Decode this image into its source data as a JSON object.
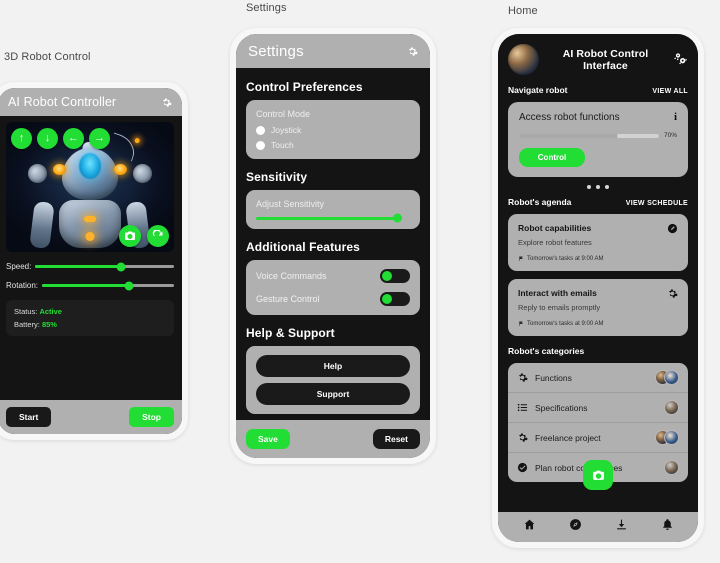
{
  "panels": {
    "robot_control": {
      "label": "3D Robot Control",
      "header": {
        "title": "AI Robot Controller",
        "gear_icon": "gear-icon"
      },
      "dpad": [
        {
          "name": "move-up",
          "glyph": "↑"
        },
        {
          "name": "move-down",
          "glyph": "↓"
        },
        {
          "name": "move-left",
          "glyph": "←"
        },
        {
          "name": "move-right",
          "glyph": "→"
        }
      ],
      "viewport_actions": [
        {
          "name": "camera-icon"
        },
        {
          "name": "refresh-icon"
        }
      ],
      "sliders": [
        {
          "label": "Speed:",
          "value": 62
        },
        {
          "label": "Rotation:",
          "value": 66
        }
      ],
      "status": {
        "status_label": "Status:",
        "status_value": "Active",
        "battery_label": "Battery:",
        "battery_value": "85%"
      },
      "footer": {
        "start_label": "Start",
        "stop_label": "Stop"
      }
    },
    "settings": {
      "label": "Settings",
      "header": {
        "title": "Settings",
        "gear_icon": "gear-icon"
      },
      "sections": {
        "control_preferences": {
          "title": "Control Preferences",
          "card_label": "Control Mode",
          "options": [
            "Joystick",
            "Touch"
          ]
        },
        "sensitivity": {
          "title": "Sensitivity",
          "card_label": "Adjust Sensitivity",
          "value": 88
        },
        "additional_features": {
          "title": "Additional Features",
          "toggles": [
            {
              "label": "Voice Commands",
              "on": true
            },
            {
              "label": "Gesture Control",
              "on": true
            }
          ]
        },
        "help_support": {
          "title": "Help & Support",
          "buttons": [
            "Help",
            "Support"
          ]
        }
      },
      "footer": {
        "save_label": "Save",
        "reset_label": "Reset"
      }
    },
    "home": {
      "label": "Home",
      "header": {
        "title": "AI Robot Control Interface",
        "avatar": "robot-avatar",
        "gears_icon": "gears-icon"
      },
      "navigate_section": {
        "title": "Navigate robot",
        "link": "VIEW ALL"
      },
      "hero_card": {
        "title": "Access robot functions",
        "info_icon": "info-icon",
        "progress_pct": "70%",
        "progress_value": 70,
        "button_label": "Control"
      },
      "carousel_dots": 3,
      "agenda_section": {
        "title": "Robot's agenda",
        "link": "VIEW SCHEDULE"
      },
      "agenda_cards": [
        {
          "title": "Robot capabilities",
          "subtitle": "Explore robot features",
          "meta": "Tomorrow's tasks at 9:00 AM",
          "icon": "edit-circle-icon"
        },
        {
          "title": "Interact with emails",
          "subtitle": "Reply to emails promptly",
          "meta": "Tomorrow's tasks at 9:00 AM",
          "icon": "gear-icon"
        }
      ],
      "categories_section": {
        "title": "Robot's categories"
      },
      "categories": [
        {
          "label": "Functions",
          "icon": "gear-icon",
          "avatars": 2
        },
        {
          "label": "Specifications",
          "icon": "list-icon",
          "avatars": 1
        },
        {
          "label": "Freelance project",
          "icon": "gear-icon",
          "avatars": 2
        },
        {
          "label": "Plan robot conferences",
          "icon": "check-circle-icon",
          "avatars": 1
        }
      ],
      "fab": {
        "icon": "camera-icon"
      },
      "navbar": [
        {
          "name": "home-icon"
        },
        {
          "name": "compass-icon"
        },
        {
          "name": "download-icon"
        },
        {
          "name": "bell-icon"
        }
      ]
    }
  },
  "colors": {
    "accent_green": "#22dd33",
    "page_bg": "#f2f2f2",
    "screen_bg": "#141414",
    "bar_gray": "#b0b0b0"
  }
}
